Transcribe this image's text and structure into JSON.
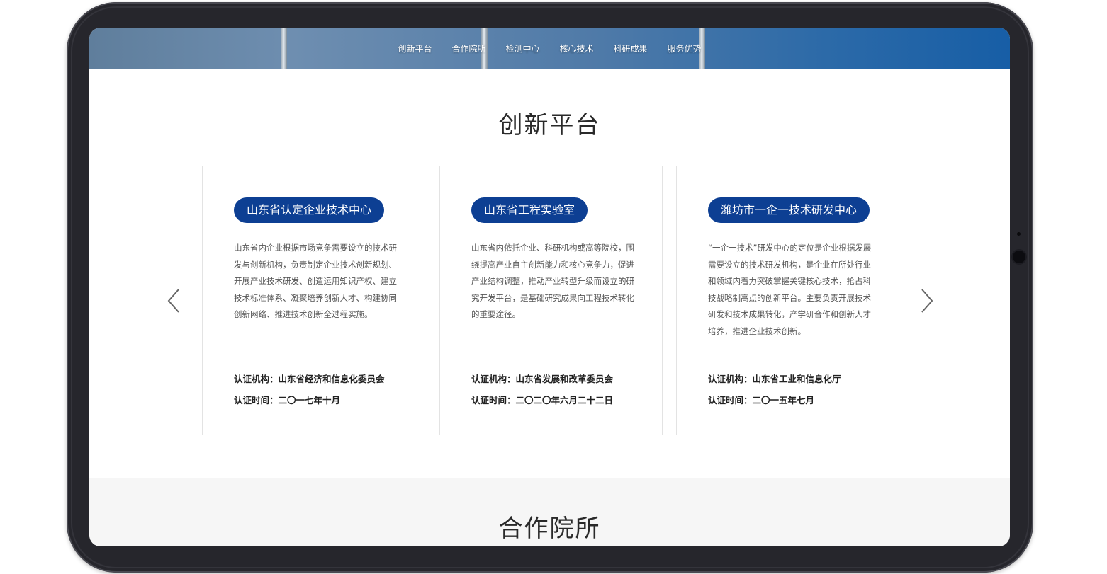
{
  "nav": {
    "items": [
      "创新平台",
      "合作院所",
      "检测中心",
      "核心技术",
      "科研成果",
      "服务优势"
    ]
  },
  "section1": {
    "title": "创新平台"
  },
  "carousel": {
    "prev_icon": "chevron-left-icon",
    "next_icon": "chevron-right-icon",
    "cards": [
      {
        "title": "山东省认定企业技术中心",
        "description": "山东省内企业根据市场竞争需要设立的技术研发与创新机构，负责制定企业技术创新规划、开展产业技术研发、创造运用知识产权、建立技术标准体系、凝聚培养创新人才、构建协同创新网络、推进技术创新全过程实施。",
        "authority": "认证机构：山东省经济和信息化委员会",
        "date": "认证时间：二〇一七年十月"
      },
      {
        "title": "山东省工程实验室",
        "description": "山东省内依托企业、科研机构或高等院校，围绕提高产业自主创新能力和核心竞争力，促进产业结构调整，推动产业转型升级而设立的研究开发平台，是基础研究成果向工程技术转化的重要途径。",
        "authority": "认证机构：山东省发展和改革委员会",
        "date": "认证时间：二〇二〇年六月二十二日"
      },
      {
        "title": "潍坊市一企一技术研发中心",
        "description": "“一企一技术”研发中心的定位是企业根据发展需要设立的技术研发机构，是企业在所处行业和领域内着力突破掌握关键核心技术，抢占科技战略制高点的创新平台。主要负责开展技术研发和技术成果转化，产学研合作和创新人才培养，推进企业技术创新。",
        "authority": "认证机构：山东省工业和信息化厅",
        "date": "认证时间：二〇一五年七月"
      }
    ]
  },
  "section2": {
    "title": "合作院所"
  },
  "colors": {
    "accent": "#0d3f93",
    "banner": "#175ea6",
    "frame": "#26262c"
  }
}
